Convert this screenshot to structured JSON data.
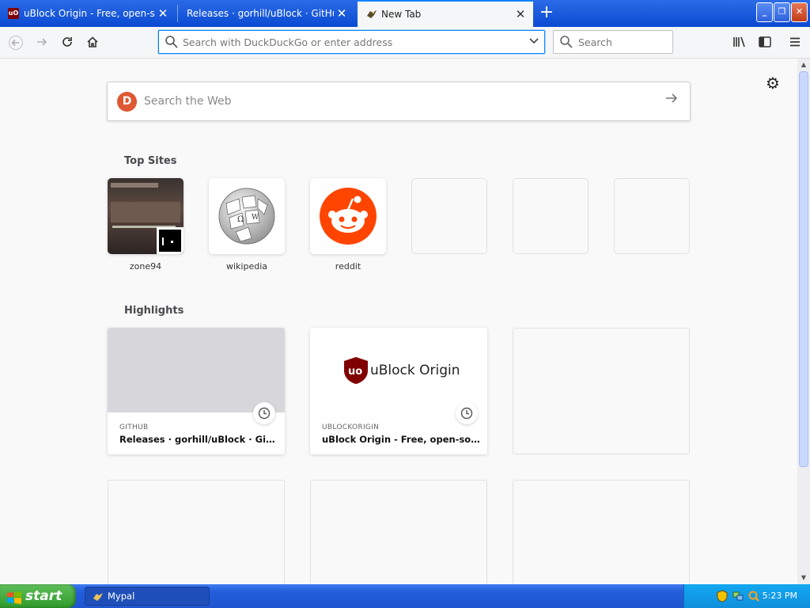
{
  "tabs": [
    {
      "title": "uBlock Origin - Free, open-source",
      "favicon": "ublock-icon",
      "active": false
    },
    {
      "title": "Releases · gorhill/uBlock · GitHub",
      "favicon": "none",
      "active": false
    },
    {
      "title": "New Tab",
      "favicon": "mypal-icon",
      "active": true
    }
  ],
  "toolbar": {
    "url_placeholder": "Search with DuckDuckGo or enter address",
    "search_placeholder": "Search"
  },
  "newtab": {
    "websearch_placeholder": "Search the Web",
    "top_sites_heading": "Top Sites",
    "highlights_heading": "Highlights",
    "top_sites": [
      {
        "label": "zone94"
      },
      {
        "label": "wikipedia"
      },
      {
        "label": "reddit"
      }
    ],
    "highlights": [
      {
        "host": "GITHUB",
        "title": "Releases · gorhill/uBlock · GitHub"
      },
      {
        "host": "UBLOCKORIGIN",
        "title": "uBlock Origin - Free, open-source...",
        "logo_text": "uBlock Origin"
      }
    ]
  },
  "taskbar": {
    "start_label": "start",
    "task_label": "Mypal",
    "clock": "5:23 PM"
  },
  "colors": {
    "accent": "#0a84ff",
    "reddit": "#ff4500",
    "ublock": "#800000",
    "xp_blue": "#245edb",
    "xp_green": "#2f9a2c"
  }
}
